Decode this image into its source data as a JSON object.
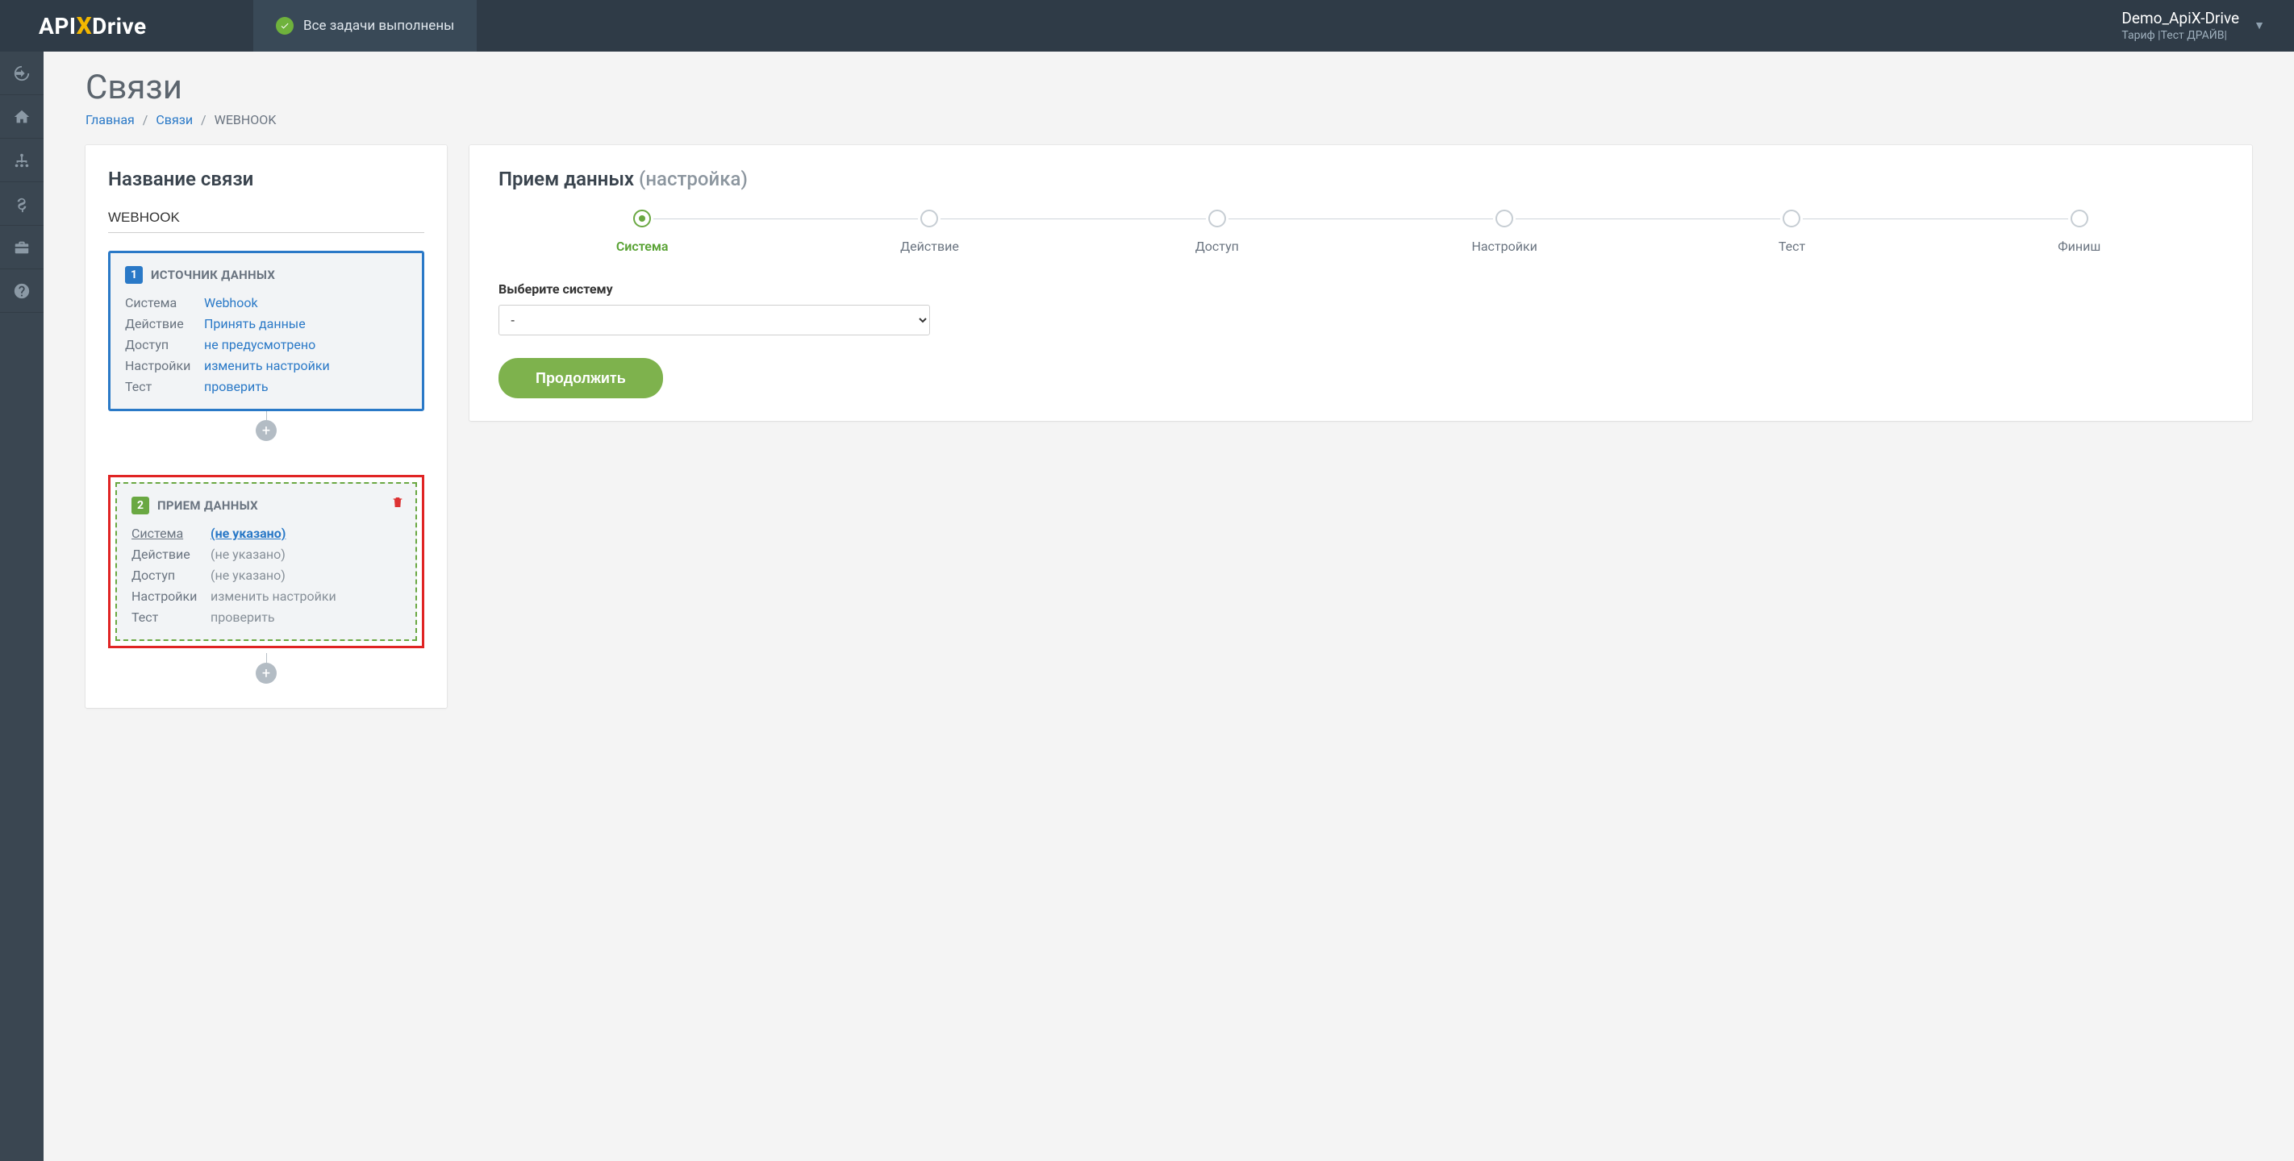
{
  "header": {
    "logo_pre": "API",
    "logo_x": "X",
    "logo_post": "Drive",
    "status_text": "Все задачи выполнены",
    "account_name": "Demo_ApiX-Drive",
    "account_plan": "Тариф |Тест ДРАЙВ|"
  },
  "page": {
    "title": "Связи",
    "breadcrumb": {
      "home": "Главная",
      "links": "Связи",
      "current": "WEBHOOK"
    }
  },
  "left": {
    "section_title": "Название связи",
    "name_value": "WEBHOOK",
    "source": {
      "num": "1",
      "title": "ИСТОЧНИК ДАННЫХ",
      "rows": {
        "system_k": "Система",
        "system_v": "Webhook",
        "action_k": "Действие",
        "action_v": "Принять данные",
        "access_k": "Доступ",
        "access_v": "не предусмотрено",
        "settings_k": "Настройки",
        "settings_v": "изменить настройки",
        "test_k": "Тест",
        "test_v": "проверить"
      }
    },
    "dest": {
      "num": "2",
      "title": "ПРИЕМ ДАННЫХ",
      "rows": {
        "system_k": "Система",
        "system_v": "(не указано)",
        "action_k": "Действие",
        "action_v": "(не указано)",
        "access_k": "Доступ",
        "access_v": "(не указано)",
        "settings_k": "Настройки",
        "settings_v": "изменить настройки",
        "test_k": "Тест",
        "test_v": "проверить"
      }
    }
  },
  "right": {
    "title_main": "Прием данных ",
    "title_sub": "(настройка)",
    "steps": [
      "Система",
      "Действие",
      "Доступ",
      "Настройки",
      "Тест",
      "Финиш"
    ],
    "field_label": "Выберите систему",
    "select_value": "-",
    "continue_label": "Продолжить"
  }
}
